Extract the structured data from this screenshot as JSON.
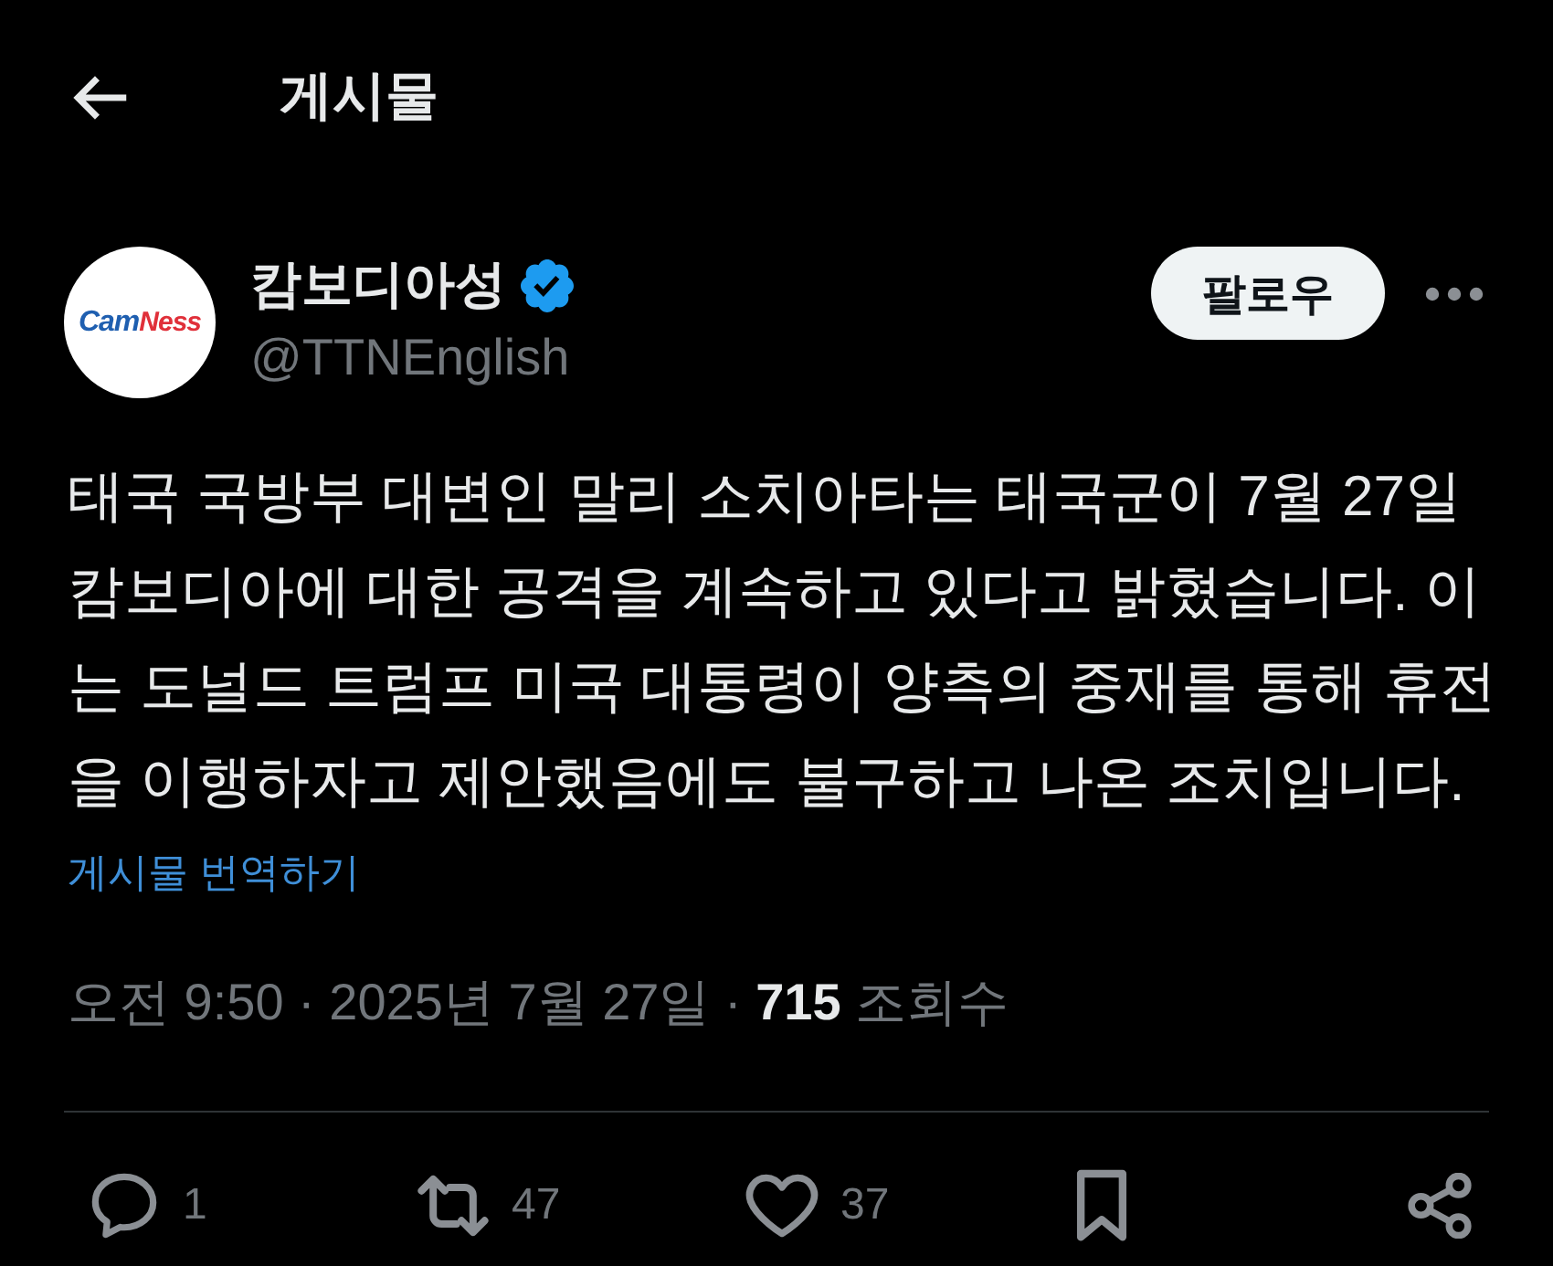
{
  "header": {
    "title": "게시물"
  },
  "author": {
    "name": "캄보디아성",
    "verified": true,
    "handle": "@TTNEnglish",
    "logo": [
      {
        "text": "Cam",
        "color": "#1f5fb0"
      },
      {
        "text": "Ness",
        "color": "#e0303a"
      }
    ]
  },
  "follow_button": {
    "label": "팔로우"
  },
  "post": {
    "text": "태국 국방부 대변인 말리 소치아타는 태국군이 7월 27일 캄보디아에 대한 공격을 계속하고 있다고 밝혔습니다. 이는 도널드 트럼프 미국 대통령이 양측의 중재를 통해 휴전을 이행하자고 제안했음에도 불구하고 나온 조치입니다.",
    "translate_link": "게시물 번역하기",
    "meta": "오전 9:50 · 2025년 7월 27일 · **715** 조회수"
  },
  "actions": [
    {
      "kind": "reply",
      "count": "1"
    },
    {
      "kind": "repost",
      "count": "47"
    },
    {
      "kind": "like",
      "count": "37"
    },
    {
      "kind": "bookmark"
    },
    {
      "kind": "share"
    }
  ]
}
